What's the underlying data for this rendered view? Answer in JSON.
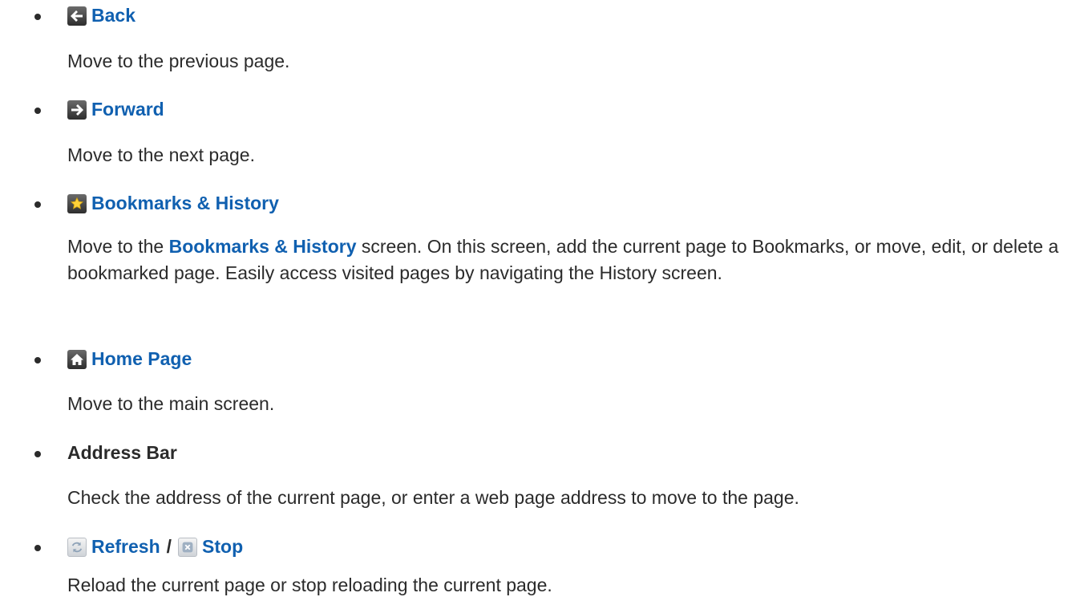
{
  "items": [
    {
      "icon": "arrow-left-icon",
      "title": "Back",
      "description": "Move to the previous page."
    },
    {
      "icon": "arrow-right-icon",
      "title": "Forward",
      "description": "Move to the next page."
    },
    {
      "icon": "star-icon",
      "title": "Bookmarks & History",
      "description_before": "Move to the ",
      "description_highlight": "Bookmarks & History",
      "description_after": " screen. On this screen, add the current page to Bookmarks, or move, edit, or delete a bookmarked page. Easily access visited pages by navigating the History screen."
    },
    {
      "icon": "home-icon",
      "title": "Home Page",
      "description": "Move to the main screen."
    },
    {
      "title": "Address Bar",
      "description": "Check the address of the current page, or enter a web page address to move to the page."
    },
    {
      "icon": "refresh-icon",
      "title": "Refresh",
      "separator": "/",
      "icon2": "stop-icon",
      "title2": "Stop",
      "description": "Reload the current page or stop reloading the current page."
    }
  ],
  "colors": {
    "accent": "#1060b0",
    "text": "#2b2b2b"
  }
}
